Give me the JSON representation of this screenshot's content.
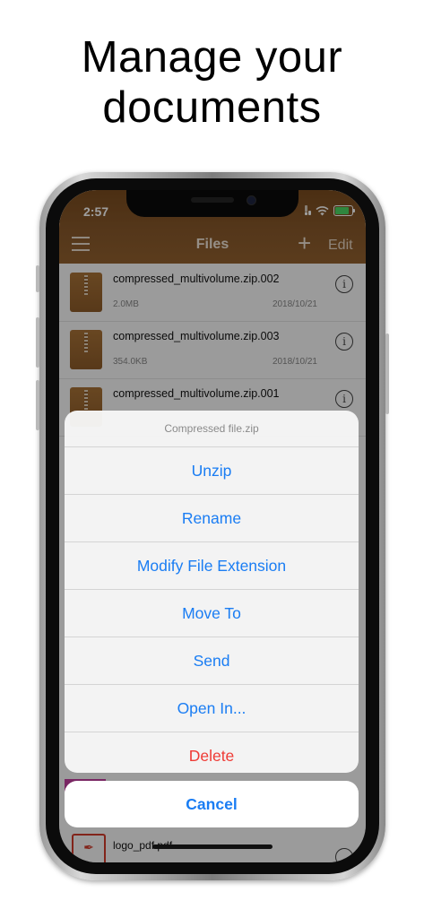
{
  "headline": {
    "line1": "Manage your",
    "line2": "documents"
  },
  "status_bar": {
    "time": "2:57"
  },
  "nav": {
    "title": "Files",
    "add_label": "+",
    "edit_label": "Edit"
  },
  "files": [
    {
      "name": "compressed_multivolume.zip.002",
      "size": "2.0MB",
      "date": "2018/10/21"
    },
    {
      "name": "compressed_multivolume.zip.003",
      "size": "354.0KB",
      "date": "2018/10/21"
    },
    {
      "name": "compressed_multivolume.zip.001",
      "size": "",
      "date": ""
    }
  ],
  "bottom_file": {
    "name": "logo_pdf.pdf"
  },
  "action_sheet": {
    "title": "Compressed file.zip",
    "items": [
      {
        "label": "Unzip"
      },
      {
        "label": "Rename"
      },
      {
        "label": "Modify File Extension"
      },
      {
        "label": "Move To"
      },
      {
        "label": "Send"
      },
      {
        "label": "Open In..."
      },
      {
        "label": "Delete"
      }
    ],
    "cancel_label": "Cancel"
  },
  "colors": {
    "nav_brown": "#8a5a2c",
    "action_blue": "#1a7df3",
    "destructive_red": "#ef3b35"
  },
  "icons": {
    "menu": "hamburger-menu-icon",
    "add": "plus-icon",
    "file": "zip-file-icon",
    "info": "info-circle-icon",
    "pdf": "pdf-file-icon"
  }
}
